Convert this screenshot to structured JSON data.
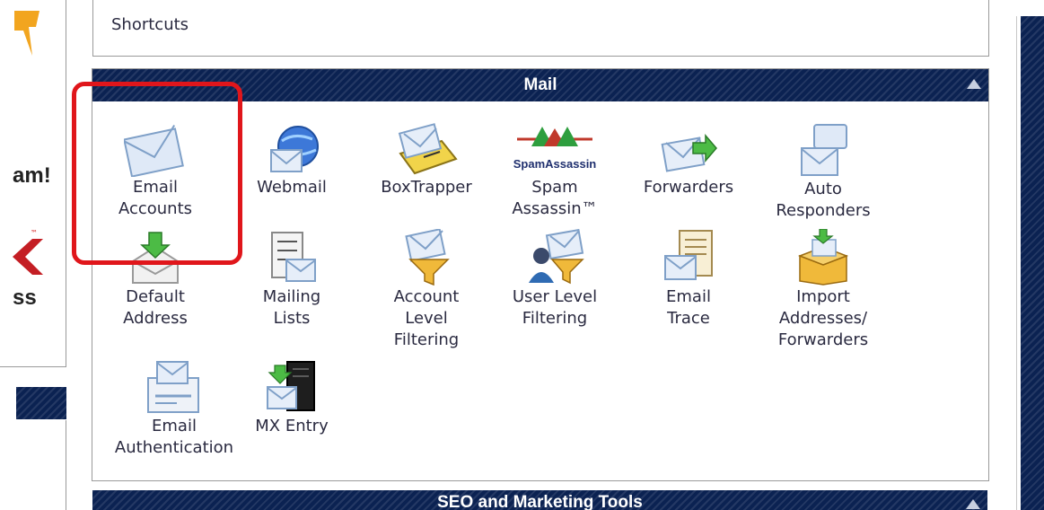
{
  "sidebar": {
    "fragment_1": "am!",
    "fragment_2": "ss",
    "trademark": "™"
  },
  "shortcuts": {
    "title": "Shortcuts"
  },
  "mail": {
    "title": "Mail",
    "items": [
      {
        "label": "Email\nAccounts",
        "icon": "envelope-icon"
      },
      {
        "label": "Webmail",
        "icon": "globe-envelope-icon"
      },
      {
        "label": "BoxTrapper",
        "icon": "trap-icon"
      },
      {
        "label": "Spam\nAssassin™",
        "icon": "spamassassin-icon",
        "logo_text": "SpamAssassin"
      },
      {
        "label": "Forwarders",
        "icon": "forward-envelope-icon"
      },
      {
        "label": "Auto\nResponders",
        "icon": "speech-envelope-icon"
      },
      {
        "label": "Default\nAddress",
        "icon": "open-envelope-arrow-icon"
      },
      {
        "label": "Mailing\nLists",
        "icon": "list-envelope-icon"
      },
      {
        "label": "Account\nLevel\nFiltering",
        "icon": "funnel-envelope-icon"
      },
      {
        "label": "User Level\nFiltering",
        "icon": "user-funnel-icon"
      },
      {
        "label": "Email\nTrace",
        "icon": "document-envelope-icon"
      },
      {
        "label": "Import\nAddresses/\nForwarders",
        "icon": "box-import-icon"
      },
      {
        "label": "Email\nAuthentication",
        "icon": "certificate-envelope-icon"
      },
      {
        "label": "MX Entry",
        "icon": "server-envelope-icon"
      }
    ]
  },
  "next_section": {
    "title": "SEO and Marketing Tools"
  },
  "colors": {
    "header_bg": "#0b2252",
    "highlight": "#e0161b",
    "text": "#2a2a40"
  }
}
